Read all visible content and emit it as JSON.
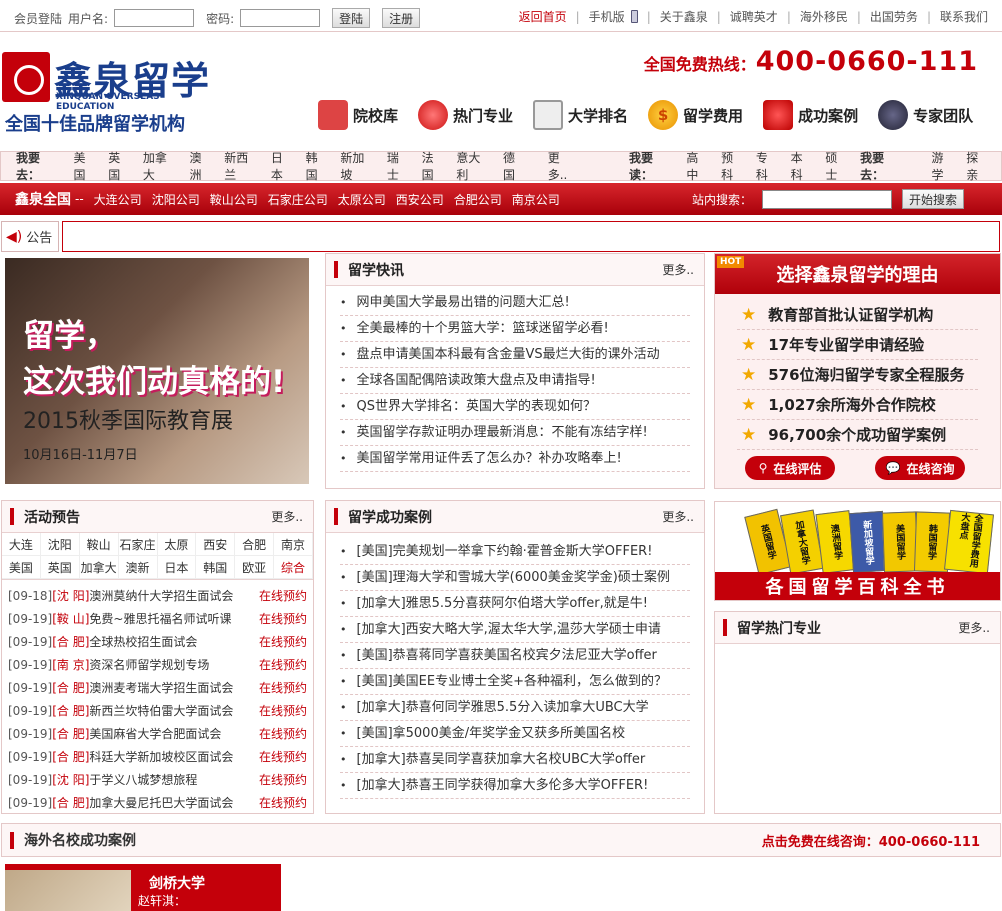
{
  "topbar": {
    "member_login": "会员登陆",
    "username_label": "用户名:",
    "password_label": "密码:",
    "login_btn": "登陆",
    "register_btn": "注册",
    "links": [
      "返回首页",
      "手机版",
      "关于鑫泉",
      "诚聘英才",
      "海外移民",
      "出国劳务",
      "联系我们"
    ]
  },
  "logo": {
    "cn": "鑫泉留学",
    "en": "XINQUAN OVERSEAS EDUCATION",
    "slogan": "全国十佳品牌留学机构"
  },
  "hotline": {
    "label": "全国免费热线：",
    "number": "400-0660-111"
  },
  "mainnav": [
    {
      "label": "院校库",
      "icon": "house-icon",
      "color": "#c33"
    },
    {
      "label": "热门专业",
      "icon": "bulb-icon",
      "color": "#e33"
    },
    {
      "label": "大学排名",
      "icon": "notepad-icon",
      "color": "#888"
    },
    {
      "label": "留学费用",
      "icon": "coin-icon",
      "color": "#f0a000"
    },
    {
      "label": "成功案例",
      "icon": "medal-icon",
      "color": "#c22"
    },
    {
      "label": "专家团队",
      "icon": "person-icon",
      "color": "#335"
    }
  ],
  "gobar": {
    "go_label": "我要去：",
    "countries": [
      "美国",
      "英国",
      "加拿大",
      "澳洲",
      "新西兰",
      "日本",
      "韩国",
      "新加坡",
      "瑞士",
      "法国",
      "意大利",
      "德国"
    ],
    "more": "更多..",
    "read_label": "我要读：",
    "levels": [
      "高中",
      "预科",
      "专科",
      "本科",
      "硕士"
    ],
    "go_label2": "我要去：",
    "types": [
      "游学",
      "探亲"
    ]
  },
  "redbar": {
    "brand": "鑫泉全国",
    "dash": "--",
    "companies": [
      "大连公司",
      "沈阳公司",
      "鞍山公司",
      "石家庄公司",
      "太原公司",
      "西安公司",
      "合肥公司",
      "南京公司"
    ],
    "search_label": "站内搜索：",
    "search_btn": "开始搜索"
  },
  "notice": {
    "label": "公告"
  },
  "banner": {
    "line1": "留学，",
    "line2": "这次我们动真格的!",
    "line3": "2015秋季国际教育展",
    "line4": "10月16日-11月7日"
  },
  "news": {
    "title": "留学快讯",
    "more": "更多..",
    "items": [
      "网申美国大学最易出错的问题大汇总!",
      "全美最棒的十个男篮大学：篮球迷留学必看!",
      "盘点申请美国本科最有含金量VS最烂大街的课外活动",
      "全球各国配偶陪读政策大盘点及申请指导!",
      "QS世界大学排名：英国大学的表现如何？",
      "英国留学存款证明办理最新消息：不能有冻结字样!",
      "美国留学常用证件丢了怎么办？补办攻略奉上!"
    ]
  },
  "reasons": {
    "hot": "HOT",
    "title": "选择鑫泉留学的理由",
    "items": [
      "教育部首批认证留学机构",
      "17年专业留学申请经验",
      "576位海归留学专家全程服务",
      "1,027余所海外合作院校",
      "96,700余个成功留学案例"
    ],
    "btn1": "在线评估",
    "btn2": "在线咨询"
  },
  "activity": {
    "title": "活动预告",
    "more": "更多..",
    "cities": [
      "大连",
      "沈阳",
      "鞍山",
      "石家庄",
      "太原",
      "西安",
      "合肥",
      "南京",
      "美国",
      "英国",
      "加拿大",
      "澳新",
      "日本",
      "韩国",
      "欧亚",
      "综合"
    ],
    "items": [
      {
        "date": "[09-18]",
        "city": "[沈 阳]",
        "title": "澳洲莫纳什大学招生面试会"
      },
      {
        "date": "[09-19]",
        "city": "[鞍 山]",
        "title": "免费~雅思托福名师试听课"
      },
      {
        "date": "[09-19]",
        "city": "[合 肥]",
        "title": "全球热校招生面试会"
      },
      {
        "date": "[09-19]",
        "city": "[南 京]",
        "title": "资深名师留学规划专场"
      },
      {
        "date": "[09-19]",
        "city": "[合 肥]",
        "title": "澳洲麦考瑞大学招生面试会"
      },
      {
        "date": "[09-19]",
        "city": "[合 肥]",
        "title": "新西兰坎特伯雷大学面试会"
      },
      {
        "date": "[09-19]",
        "city": "[合 肥]",
        "title": "美国麻省大学合肥面试会"
      },
      {
        "date": "[09-19]",
        "city": "[合 肥]",
        "title": "科廷大学新加坡校区面试会"
      },
      {
        "date": "[09-19]",
        "city": "[沈 阳]",
        "title": "于学义八城梦想旅程"
      },
      {
        "date": "[09-19]",
        "city": "[合 肥]",
        "title": "加拿大曼尼托巴大学面试会"
      }
    ],
    "action": "在线预约"
  },
  "cases": {
    "title": "留学成功案例",
    "more": "更多..",
    "items": [
      "[美国]完美规划一举拿下约翰·霍普金斯大学OFFER!",
      "[美国]理海大学和雪城大学(6000美金奖学金)硕士案例",
      "[加拿大]雅思5.5分喜获阿尔伯塔大学offer,就是牛!",
      "[加拿大]西安大略大学,渥太华大学,温莎大学硕士申请",
      "[美国]恭喜蒋同学喜获美国名校宾夕法尼亚大学offer",
      "[美国]美国EE专业博士全奖+各种福利，怎么做到的？",
      "[加拿大]恭喜何同学雅思5.5分入读加拿大UBC大学",
      "[美国]拿5000美金/年奖学金又获多所美国名校",
      "[加拿大]恭喜吴同学喜获加拿大名校UBC大学offer",
      "[加拿大]恭喜王同学获得加拿大多伦多大学OFFER!"
    ]
  },
  "ency": {
    "books": [
      "英国留学",
      "加拿大留学",
      "澳洲留学",
      "新加坡留学",
      "美国留学",
      "韩国留学",
      "全国留学费用大盘点"
    ],
    "footer": "各国留学百科全书"
  },
  "majors": {
    "title": "留学热门专业",
    "more": "更多.."
  },
  "bottom": {
    "title": "海外名校成功案例",
    "cta": "点击免费在线咨询：400-0660-111"
  },
  "casecard": {
    "school": "剑桥大学",
    "student": "赵轩淇："
  }
}
